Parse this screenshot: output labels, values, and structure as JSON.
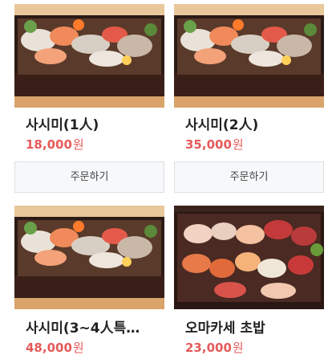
{
  "menu": {
    "items": [
      {
        "name": "사시미(1人)",
        "price": "18,000",
        "unit": "원",
        "button": "주문하기",
        "image": "sashimi-box"
      },
      {
        "name": "사시미(2人)",
        "price": "35,000",
        "unit": "원",
        "button": "주문하기",
        "image": "sashimi-box"
      },
      {
        "name": "사시미(3~4人특…",
        "price": "48,000",
        "unit": "원",
        "image": "sashimi-box"
      },
      {
        "name": "오마카세 초밥",
        "price": "23,000",
        "unit": "원",
        "image": "nigiri-box"
      }
    ]
  },
  "colors": {
    "price": "#e65a5a",
    "button_bg": "#f7f8fa",
    "button_border": "#dcdfe3"
  }
}
